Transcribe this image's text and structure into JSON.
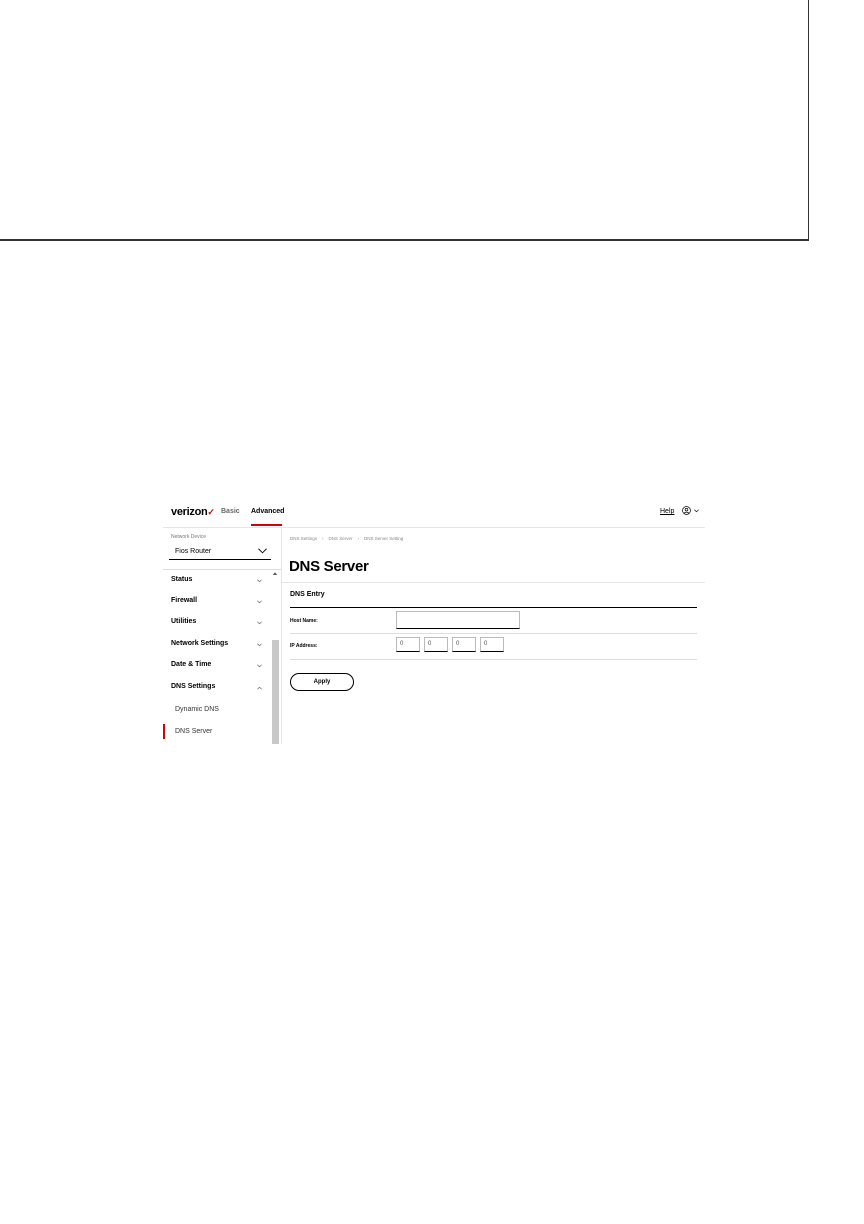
{
  "header": {
    "logo": "verizon",
    "logo_mark": "✓",
    "tabs": [
      {
        "label": "Basic",
        "active": false
      },
      {
        "label": "Advanced",
        "active": true
      }
    ],
    "help": "Help",
    "user_icon": "user-circle-icon",
    "accent_color": "#cd040b"
  },
  "sidebar": {
    "device_label": "Network Device",
    "device_value": "Fios Router",
    "menu": [
      {
        "label": "Status"
      },
      {
        "label": "Firewall"
      },
      {
        "label": "Utilities"
      },
      {
        "label": "Network Settings"
      },
      {
        "label": "Date & Time"
      },
      {
        "label": "DNS Settings",
        "expanded": true
      }
    ],
    "submenu": [
      {
        "label": "Dynamic DNS",
        "active": false
      },
      {
        "label": "DNS Server",
        "active": true
      }
    ]
  },
  "main": {
    "breadcrumb": [
      "DNS Settings",
      "DNS Server",
      "DNS Server Setting"
    ],
    "title": "DNS Server",
    "section_title": "DNS Entry",
    "host_name_label": "Host Name:",
    "host_name_value": "",
    "ip_address_label": "IP Address:",
    "ip_octets": [
      "0",
      "0",
      "0",
      "0"
    ],
    "apply_label": "Apply"
  }
}
